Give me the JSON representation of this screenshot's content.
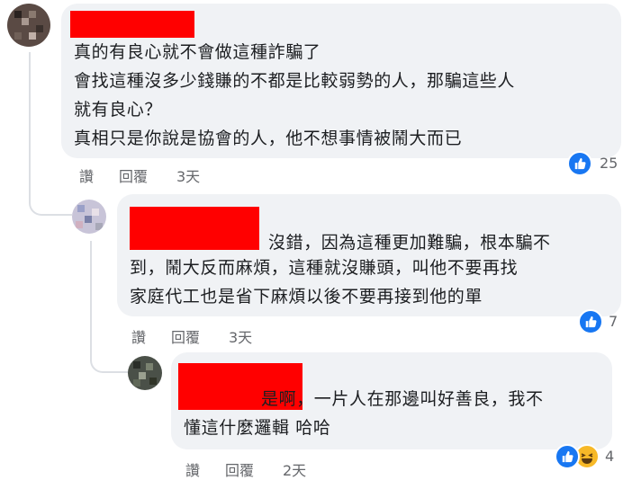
{
  "comments": [
    {
      "lines": [
        "真的有良心就不會做這種詐騙了",
        "會找這種沒多少錢賺的不都是比較弱勢的人，那騙這些人",
        "就有良心？",
        "真相只是你說是協會的人，他不想事情被鬧大而已"
      ],
      "like_label": "讚",
      "reply_label": "回覆",
      "time": "3天",
      "reaction_count": "25"
    },
    {
      "lines": [
        "沒錯，因為這種更加難騙，根本騙不",
        "到，鬧大反而麻煩，這種就沒賺頭，叫他不要再找",
        "家庭代工也是省下麻煩以後不要再接到他的單"
      ],
      "like_label": "讚",
      "reply_label": "回覆",
      "time": "3天",
      "reaction_count": "7"
    },
    {
      "lines": [
        "是啊，一片人在那邊叫好善良，我不",
        "懂這什麼邏輯 哈哈"
      ],
      "like_label": "讚",
      "reply_label": "回覆",
      "time": "2天",
      "reaction_count": "4"
    }
  ],
  "colors": {
    "bubble": "#f0f2f5",
    "redaction": "#ff0000",
    "like_blue": "#1877f2",
    "meta_gray": "#65676b"
  },
  "icons": {
    "like": "thumbs-up-icon",
    "haha": "haha-emoji-icon"
  }
}
